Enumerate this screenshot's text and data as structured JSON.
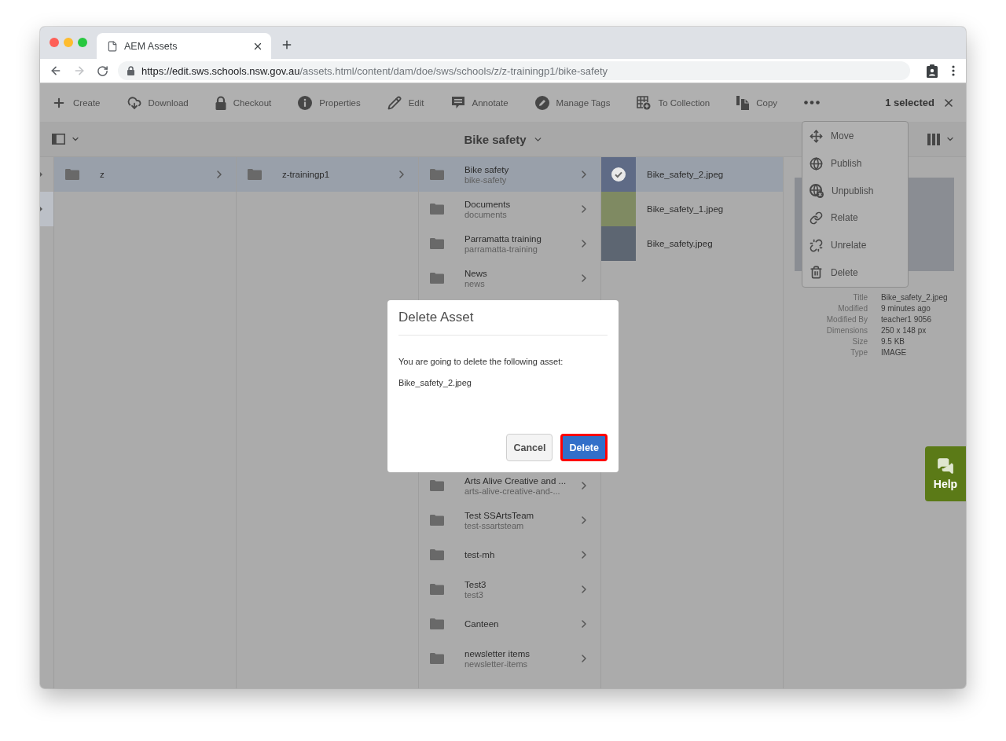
{
  "browser": {
    "tab_title": "AEM Assets",
    "url_host": "https://edit.sws.schools.nsw.gov.au",
    "url_path": "/assets.html/content/dam/doe/sws/schools/z/z-trainingp1/bike-safety",
    "forward_disabled": true
  },
  "toolbar": {
    "actions": [
      {
        "kind": "create",
        "label": "Create"
      },
      {
        "kind": "download",
        "label": "Download"
      },
      {
        "kind": "checkout",
        "label": "Checkout"
      },
      {
        "kind": "properties",
        "label": "Properties"
      },
      {
        "kind": "edit",
        "label": "Edit"
      },
      {
        "kind": "annotate",
        "label": "Annotate"
      },
      {
        "kind": "tags",
        "label": "Manage Tags"
      },
      {
        "kind": "collection",
        "label": "To Collection"
      },
      {
        "kind": "copy",
        "label": "Copy"
      }
    ],
    "selection": "1 selected"
  },
  "header": {
    "title": "Bike safety"
  },
  "collapsed_column": {
    "rows": [
      {
        "selected": false
      },
      {
        "selected": true
      }
    ]
  },
  "columns": [
    {
      "items": [
        {
          "title": "z",
          "selected": true
        }
      ]
    },
    {
      "items": [
        {
          "title": "z-trainingp1",
          "selected": true
        }
      ]
    },
    {
      "items": [
        {
          "title": "Bike safety",
          "name": "bike-safety",
          "selected": true
        },
        {
          "title": "Documents",
          "name": "documents",
          "selected": false
        },
        {
          "title": "Parramatta training",
          "name": "parramatta-training",
          "selected": false
        },
        {
          "title": "News",
          "name": "news",
          "selected": false
        }
      ],
      "lower_items": [
        {
          "title": "Arts Alive Creative and ...",
          "name": "arts-alive-creative-and-...",
          "selected": false
        },
        {
          "title": "Test SSArtsTeam",
          "name": "test-ssartsteam",
          "selected": false
        },
        {
          "title": "test-mh",
          "selected": false
        },
        {
          "title": "Test3",
          "name": "test3",
          "selected": false
        },
        {
          "title": "Canteen",
          "selected": false
        },
        {
          "title": "newsletter items",
          "name": "newsletter-items",
          "selected": false
        }
      ]
    }
  ],
  "assets": {
    "items": [
      {
        "name": "Bike_safety_2.jpeg",
        "selected": true
      },
      {
        "name": "Bike_safety_1.jpeg",
        "selected": false
      },
      {
        "name": "Bike_safety.jpeg",
        "selected": false
      }
    ]
  },
  "more_menu": {
    "items": [
      {
        "kind": "move",
        "label": "Move"
      },
      {
        "kind": "publish",
        "label": "Publish"
      },
      {
        "kind": "unpublish",
        "label": "Unpublish"
      },
      {
        "kind": "relate",
        "label": "Relate"
      },
      {
        "kind": "unrelate",
        "label": "Unrelate"
      },
      {
        "kind": "delete",
        "label": "Delete"
      }
    ]
  },
  "preview": {
    "metadata": [
      {
        "label": "Title",
        "value": "Bike_safety_2.jpeg"
      },
      {
        "label": "Modified",
        "value": "9 minutes ago"
      },
      {
        "label": "Modified By",
        "value": "teacher1 9056"
      },
      {
        "label": "Dimensions",
        "value": "250 x 148 px"
      },
      {
        "label": "Size",
        "value": "9.5 KB"
      },
      {
        "label": "Type",
        "value": "IMAGE"
      }
    ]
  },
  "dialog": {
    "title": "Delete Asset",
    "message": "You are going to delete the following asset:",
    "asset": "Bike_safety_2.jpeg",
    "buttons": [
      {
        "kind": "secondary",
        "label": "Cancel",
        "highlighted": false
      },
      {
        "kind": "primary",
        "label": "Delete",
        "highlighted": true
      }
    ]
  },
  "help": {
    "label": "Help"
  }
}
